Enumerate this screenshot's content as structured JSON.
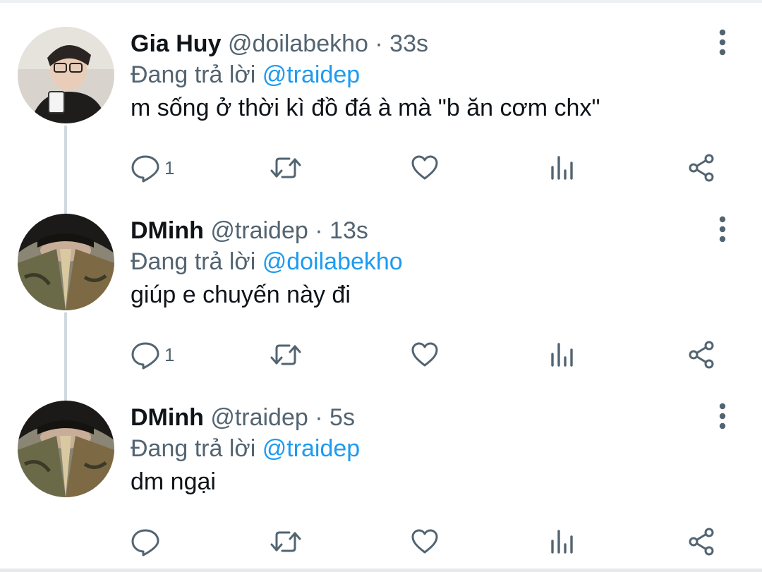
{
  "tweets": [
    {
      "name": "Gia Huy",
      "handle": "@doilabekho",
      "separator": "·",
      "time": "33s",
      "reply_prefix": "Đang trả lời",
      "reply_to": "@traidep",
      "text": "m sống ở thời kì đồ đá à mà \"b ăn cơm chx\"",
      "reply_count": "1"
    },
    {
      "name": "DMinh",
      "handle": "@traidep",
      "separator": "·",
      "time": "13s",
      "reply_prefix": "Đang trả lời",
      "reply_to": "@doilabekho",
      "text": "giúp e chuyến này đi",
      "reply_count": "1"
    },
    {
      "name": "DMinh",
      "handle": "@traidep",
      "separator": "·",
      "time": "5s",
      "reply_prefix": "Đang trả lời",
      "reply_to": "@traidep",
      "text": "dm ngại",
      "reply_count": ""
    }
  ],
  "icons": {
    "reply": "reply-icon",
    "retweet": "retweet-icon",
    "like": "heart-icon",
    "views": "analytics-icon",
    "share": "share-icon",
    "more": "more-vertical-icon"
  },
  "colors": {
    "name": "#0f1419",
    "secondary": "#536471",
    "mention": "#1d9bf0",
    "icon": "#536471",
    "thread_line": "#cfd9de"
  }
}
